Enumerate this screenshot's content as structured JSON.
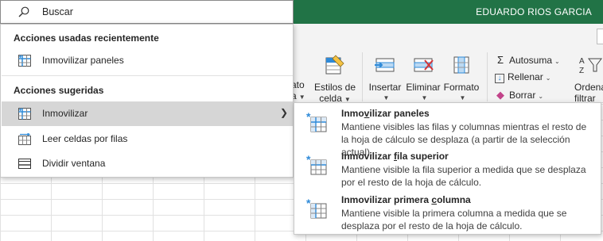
{
  "window": {
    "user_name": "EDUARDO RIOS GARCIA"
  },
  "ribbon": {
    "partial_format_label_1": "ato",
    "partial_format_label_2": "a",
    "cell_styles_label_1": "Estilos de",
    "cell_styles_label_2": "celda",
    "insert_label": "Insertar",
    "delete_label": "Eliminar",
    "format_label": "Formato",
    "autosum_label": "Autosuma",
    "fill_label": "Rellenar",
    "clear_label": "Borrar",
    "sort_label_1": "Ordena",
    "sort_label_2": "filtrar"
  },
  "search": {
    "placeholder": "Buscar"
  },
  "menu": {
    "recent_heading": "Acciones usadas recientemente",
    "recent_items": [
      {
        "label": "Inmovilizar paneles",
        "icon": "freeze-panes-icon"
      }
    ],
    "suggested_heading": "Acciones sugeridas",
    "suggested_items": [
      {
        "label": "Inmovilizar",
        "icon": "freeze-panes-icon",
        "has_submenu": true,
        "active": true
      },
      {
        "label": "Leer celdas por filas",
        "icon": "read-rows-icon"
      },
      {
        "label": "Dividir ventana",
        "icon": "split-window-icon"
      }
    ]
  },
  "submenu": {
    "items": [
      {
        "title_pre": "Inmo",
        "title_u": "v",
        "title_post": "ilizar paneles",
        "description": "Mantiene visibles las filas y columnas mientras el resto de la hoja de cálculo se desplaza (a partir de la selección actual)."
      },
      {
        "title_pre": "Inmovilizar ",
        "title_u": "f",
        "title_post": "ila superior",
        "description": "Mantiene visible la fila superior a medida que se desplaza por el resto de la hoja de cálculo."
      },
      {
        "title_pre": "Inmovilizar primera ",
        "title_u": "c",
        "title_post": "olumna",
        "description": "Mantiene visible la primera columna a medida que se desplaza por el resto de la hoja de cálculo."
      }
    ]
  },
  "colors": {
    "title_bar": "#217346",
    "accent_blue": "#2e8ad8",
    "hover_gray": "#d6d6d6"
  }
}
